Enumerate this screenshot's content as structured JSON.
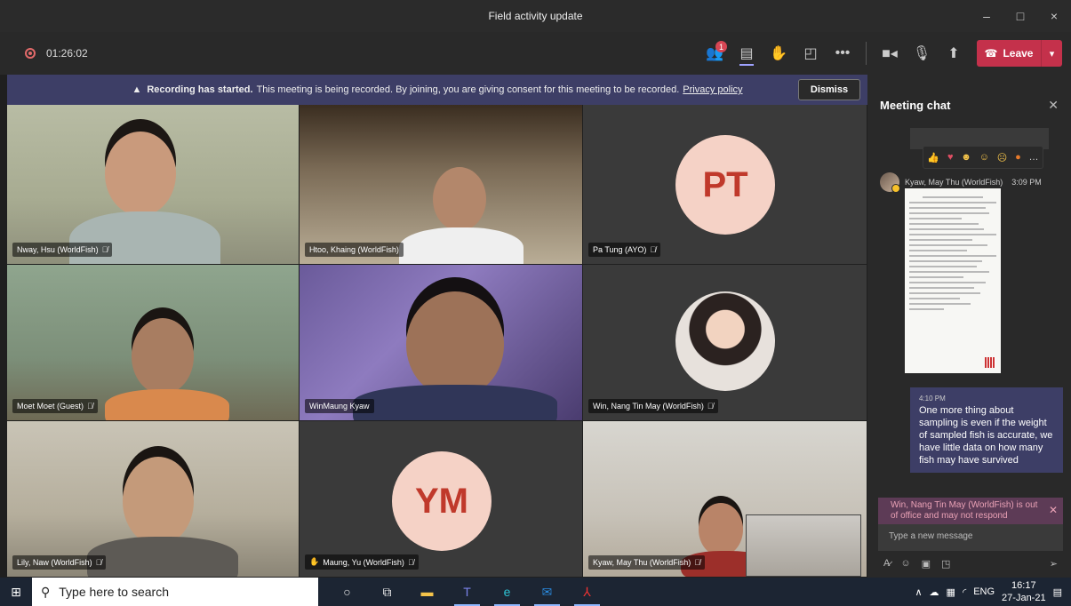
{
  "window": {
    "title": "Field activity update",
    "controls": [
      "–",
      "□",
      "×"
    ]
  },
  "toolbar": {
    "recording_time": "01:26:02",
    "participants_badge": "1",
    "leave_label": "Leave"
  },
  "banner": {
    "bold": "Recording has started.",
    "text": "This meeting is being recorded. By joining, you are giving consent for this meeting to be recorded.",
    "link": "Privacy policy",
    "dismiss_label": "Dismiss"
  },
  "participants": [
    {
      "name": "Nway, Hsu (WorldFish)",
      "muted": true
    },
    {
      "name": "Htoo, Khaing (WorldFish)",
      "muted": false
    },
    {
      "name": "Pa Tung (AYO)",
      "muted": true,
      "initials": "PT"
    },
    {
      "name": "Moet Moet (Guest)",
      "muted": true
    },
    {
      "name": "WinMaung Kyaw",
      "muted": false
    },
    {
      "name": "Win, Nang Tin May (WorldFish)",
      "muted": true
    },
    {
      "name": "Lily, Naw (WorldFish)",
      "muted": true
    },
    {
      "name": "Maung, Yu (WorldFish)",
      "muted": true,
      "initials": "YM",
      "hand_raised": true
    },
    {
      "name": "Kyaw, May Thu (WorldFish)",
      "muted": true
    }
  ],
  "chat": {
    "title": "Meeting chat",
    "message1": {
      "sender": "Kyaw, May Thu (WorldFish)",
      "time": "3:09 PM"
    },
    "message2": {
      "time": "4:10 PM",
      "text": "One more thing about sampling is even if the weight of sampled fish is accurate, we have little data on how many fish may have survived"
    },
    "out_of_office": "Win, Nang Tin May (WorldFish) is out of office and may not respond",
    "compose_placeholder": "Type a new message"
  },
  "taskbar": {
    "search_placeholder": "Type here to search",
    "language": "ENG",
    "time": "16:17",
    "date": "27-Jan-21"
  }
}
